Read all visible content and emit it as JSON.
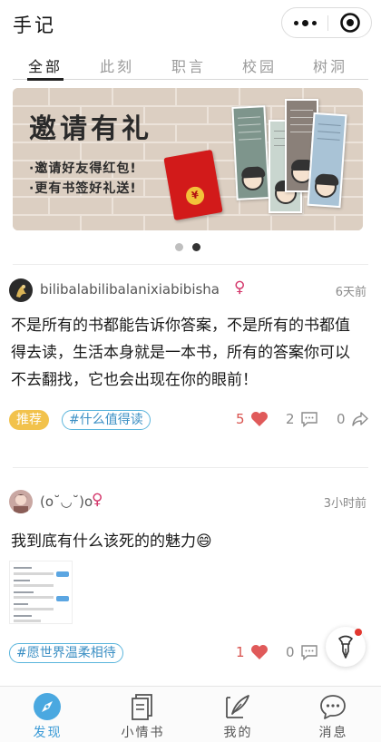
{
  "app": {
    "title": "手记"
  },
  "tabs": [
    {
      "label": "全部",
      "active": true
    },
    {
      "label": "此刻",
      "active": false
    },
    {
      "label": "职言",
      "active": false
    },
    {
      "label": "校园",
      "active": false
    },
    {
      "label": "树洞",
      "active": false
    }
  ],
  "banner": {
    "title": "邀请有礼",
    "line1": "·邀请好友得红包!",
    "line2": "·更有书签好礼送!",
    "coin": "¥",
    "slide_index": 2,
    "slide_count": 2
  },
  "posts": [
    {
      "username": "bilibalabilibalanixiabibisha",
      "gender_symbol": "♀",
      "time": "6天前",
      "lines": [
        "不是所有的书都能告诉你答案，不是所有的书都值",
        "得去读，生活本身就是一本书，所有的答案你可以",
        "不去翻找，它也会出现在你的眼前！"
      ],
      "badge": "推荐",
      "topic": "#什么值得读",
      "likes": "5",
      "comments": "2",
      "shares": "0"
    },
    {
      "username": "(o˘◡˘)o",
      "gender_symbol": "♀",
      "time": "3小时前",
      "text": "我到底有什么该死的的魅力😄",
      "topic": "#愿世界温柔相待",
      "likes": "1",
      "comments": "0"
    }
  ],
  "nav": [
    {
      "label": "发现",
      "icon": "compass-icon",
      "active": true
    },
    {
      "label": "小情书",
      "icon": "book-icon",
      "active": false
    },
    {
      "label": "我的",
      "icon": "quill-icon",
      "active": false
    },
    {
      "label": "消息",
      "icon": "chat-bubble-icon",
      "active": false
    }
  ],
  "colors": {
    "accent_blue": "#3a9ad6",
    "like_red": "#d9534f",
    "recommend_yellow": "#f2c24c",
    "female_pink": "#d4376b"
  }
}
